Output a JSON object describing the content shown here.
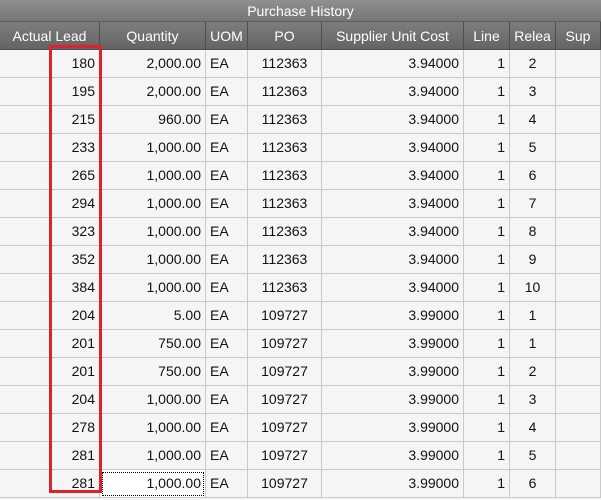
{
  "title": "Purchase History",
  "columns": [
    "Actual Lead",
    "Quantity",
    "UOM",
    "PO",
    "Supplier Unit Cost",
    "Line",
    "Relea",
    "Sup"
  ],
  "rows": [
    {
      "lead": "180",
      "qty": "2,000.00",
      "uom": "EA",
      "po": "112363",
      "cost": "3.94000",
      "line": "1",
      "release": "2"
    },
    {
      "lead": "195",
      "qty": "2,000.00",
      "uom": "EA",
      "po": "112363",
      "cost": "3.94000",
      "line": "1",
      "release": "3"
    },
    {
      "lead": "215",
      "qty": "960.00",
      "uom": "EA",
      "po": "112363",
      "cost": "3.94000",
      "line": "1",
      "release": "4"
    },
    {
      "lead": "233",
      "qty": "1,000.00",
      "uom": "EA",
      "po": "112363",
      "cost": "3.94000",
      "line": "1",
      "release": "5"
    },
    {
      "lead": "265",
      "qty": "1,000.00",
      "uom": "EA",
      "po": "112363",
      "cost": "3.94000",
      "line": "1",
      "release": "6"
    },
    {
      "lead": "294",
      "qty": "1,000.00",
      "uom": "EA",
      "po": "112363",
      "cost": "3.94000",
      "line": "1",
      "release": "7"
    },
    {
      "lead": "323",
      "qty": "1,000.00",
      "uom": "EA",
      "po": "112363",
      "cost": "3.94000",
      "line": "1",
      "release": "8"
    },
    {
      "lead": "352",
      "qty": "1,000.00",
      "uom": "EA",
      "po": "112363",
      "cost": "3.94000",
      "line": "1",
      "release": "9"
    },
    {
      "lead": "384",
      "qty": "1,000.00",
      "uom": "EA",
      "po": "112363",
      "cost": "3.94000",
      "line": "1",
      "release": "10"
    },
    {
      "lead": "204",
      "qty": "5.00",
      "uom": "EA",
      "po": "109727",
      "cost": "3.99000",
      "line": "1",
      "release": "1"
    },
    {
      "lead": "201",
      "qty": "750.00",
      "uom": "EA",
      "po": "109727",
      "cost": "3.99000",
      "line": "1",
      "release": "1"
    },
    {
      "lead": "201",
      "qty": "750.00",
      "uom": "EA",
      "po": "109727",
      "cost": "3.99000",
      "line": "1",
      "release": "2"
    },
    {
      "lead": "204",
      "qty": "1,000.00",
      "uom": "EA",
      "po": "109727",
      "cost": "3.99000",
      "line": "1",
      "release": "3"
    },
    {
      "lead": "278",
      "qty": "1,000.00",
      "uom": "EA",
      "po": "109727",
      "cost": "3.99000",
      "line": "1",
      "release": "4"
    },
    {
      "lead": "281",
      "qty": "1,000.00",
      "uom": "EA",
      "po": "109727",
      "cost": "3.99000",
      "line": "1",
      "release": "5"
    },
    {
      "lead": "281",
      "qty": "1,000.00",
      "uom": "EA",
      "po": "109727",
      "cost": "3.99000",
      "line": "1",
      "release": "6"
    }
  ],
  "colors": {
    "highlight": "#e0202a",
    "header": "#6e6e6e"
  }
}
